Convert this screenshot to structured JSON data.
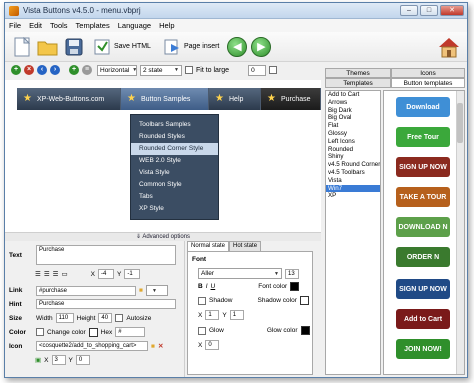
{
  "window": {
    "title": "Vista Buttons v4.5.0 - menu.vbprj"
  },
  "menu": [
    "File",
    "Edit",
    "Tools",
    "Templates",
    "Language",
    "Help"
  ],
  "toolbar": {
    "save_html": "Save HTML",
    "page_insert": "Page insert"
  },
  "toolbar2": {
    "orientation": "Horizontal",
    "state": "2 state",
    "fit_to_large": "Fit to large",
    "spacing": "0"
  },
  "preview": {
    "buttons": [
      {
        "label": "XP-Web-Buttons.com"
      },
      {
        "label": "Button Samples"
      },
      {
        "label": "Help"
      },
      {
        "label": "Purchase"
      }
    ],
    "submenu": [
      "Toolbars Samples",
      "Rounded Styles",
      "Rounded Corner Style",
      "WEB 2.0 Style",
      "Vista Style",
      "Common Style",
      "Tabs",
      "XP Style"
    ],
    "submenu_selected": 2
  },
  "advanced_options": "Advanced options",
  "props": {
    "text_label": "Text",
    "text_value": "Purchase",
    "x_label": "X",
    "x_value": "-4",
    "y_label": "Y",
    "y_value": "-1",
    "link_label": "Link",
    "link_value": "#purchase",
    "hint_label": "Hint",
    "hint_value": "Purchase",
    "size_label": "Size",
    "width_label": "Width",
    "width_value": "110",
    "height_label": "Height",
    "height_value": "40",
    "autosize": "Autosize",
    "color_label": "Color",
    "change_color": "Change color",
    "hex_label": "Hex",
    "hex_value": "#",
    "icon_label": "Icon",
    "icon_value": "<cosquette2/add_to_shopping_cart>",
    "icon_x": "3",
    "icon_y": "0"
  },
  "states": {
    "tabs": [
      "Normal state",
      "Hot state"
    ],
    "font_label": "Font",
    "font_value": "Aller",
    "font_size": "13",
    "font_color": "Font color",
    "shadow": "Shadow",
    "shadow_color": "Shadow color",
    "glow": "Glow",
    "glow_color": "Glow color",
    "sx": "1",
    "sy": "1",
    "gx": "0",
    "colors": {
      "font": "#000000",
      "shadow": "#ffffff",
      "glow": "#000000"
    }
  },
  "right_panel": {
    "tabs": [
      "Themes",
      "Icons",
      "Templates",
      "Button templates"
    ],
    "themes": [
      "Add to Cart",
      "Arrows",
      "Big Dark",
      "Big Oval",
      "Flat",
      "Glossy",
      "Left Icons",
      "Rounded",
      "Shiny",
      "v4.5 Round Corner",
      "v4.5 Toolbars",
      "Vista",
      "Win7",
      "XP"
    ],
    "selected_theme": "Win7",
    "gallery": [
      {
        "label": "Download",
        "bg": "#3f8fd6",
        "fg": "#ffffff"
      },
      {
        "label": "Free Tour",
        "bg": "#3ba83b",
        "fg": "#ffffff"
      },
      {
        "label": "SIGN UP NOW",
        "bg": "#8b2a1f",
        "fg": "#ffffff"
      },
      {
        "label": "TAKE A TOUR",
        "bg": "#b6601c",
        "fg": "#ffffff"
      },
      {
        "label": "DOWNLOAD N",
        "bg": "#5da04a",
        "fg": "#ffffff"
      },
      {
        "label": "ORDER N",
        "bg": "#3a7a2e",
        "fg": "#ffffff"
      },
      {
        "label": "SIGN UP NOW",
        "bg": "#204a86",
        "fg": "#ffffff"
      },
      {
        "label": "Add to Cart",
        "bg": "#7a1a1a",
        "fg": "#ffffff"
      },
      {
        "label": "JOIN NOW!",
        "bg": "#2f8f2b",
        "fg": "#ffffff"
      }
    ]
  }
}
